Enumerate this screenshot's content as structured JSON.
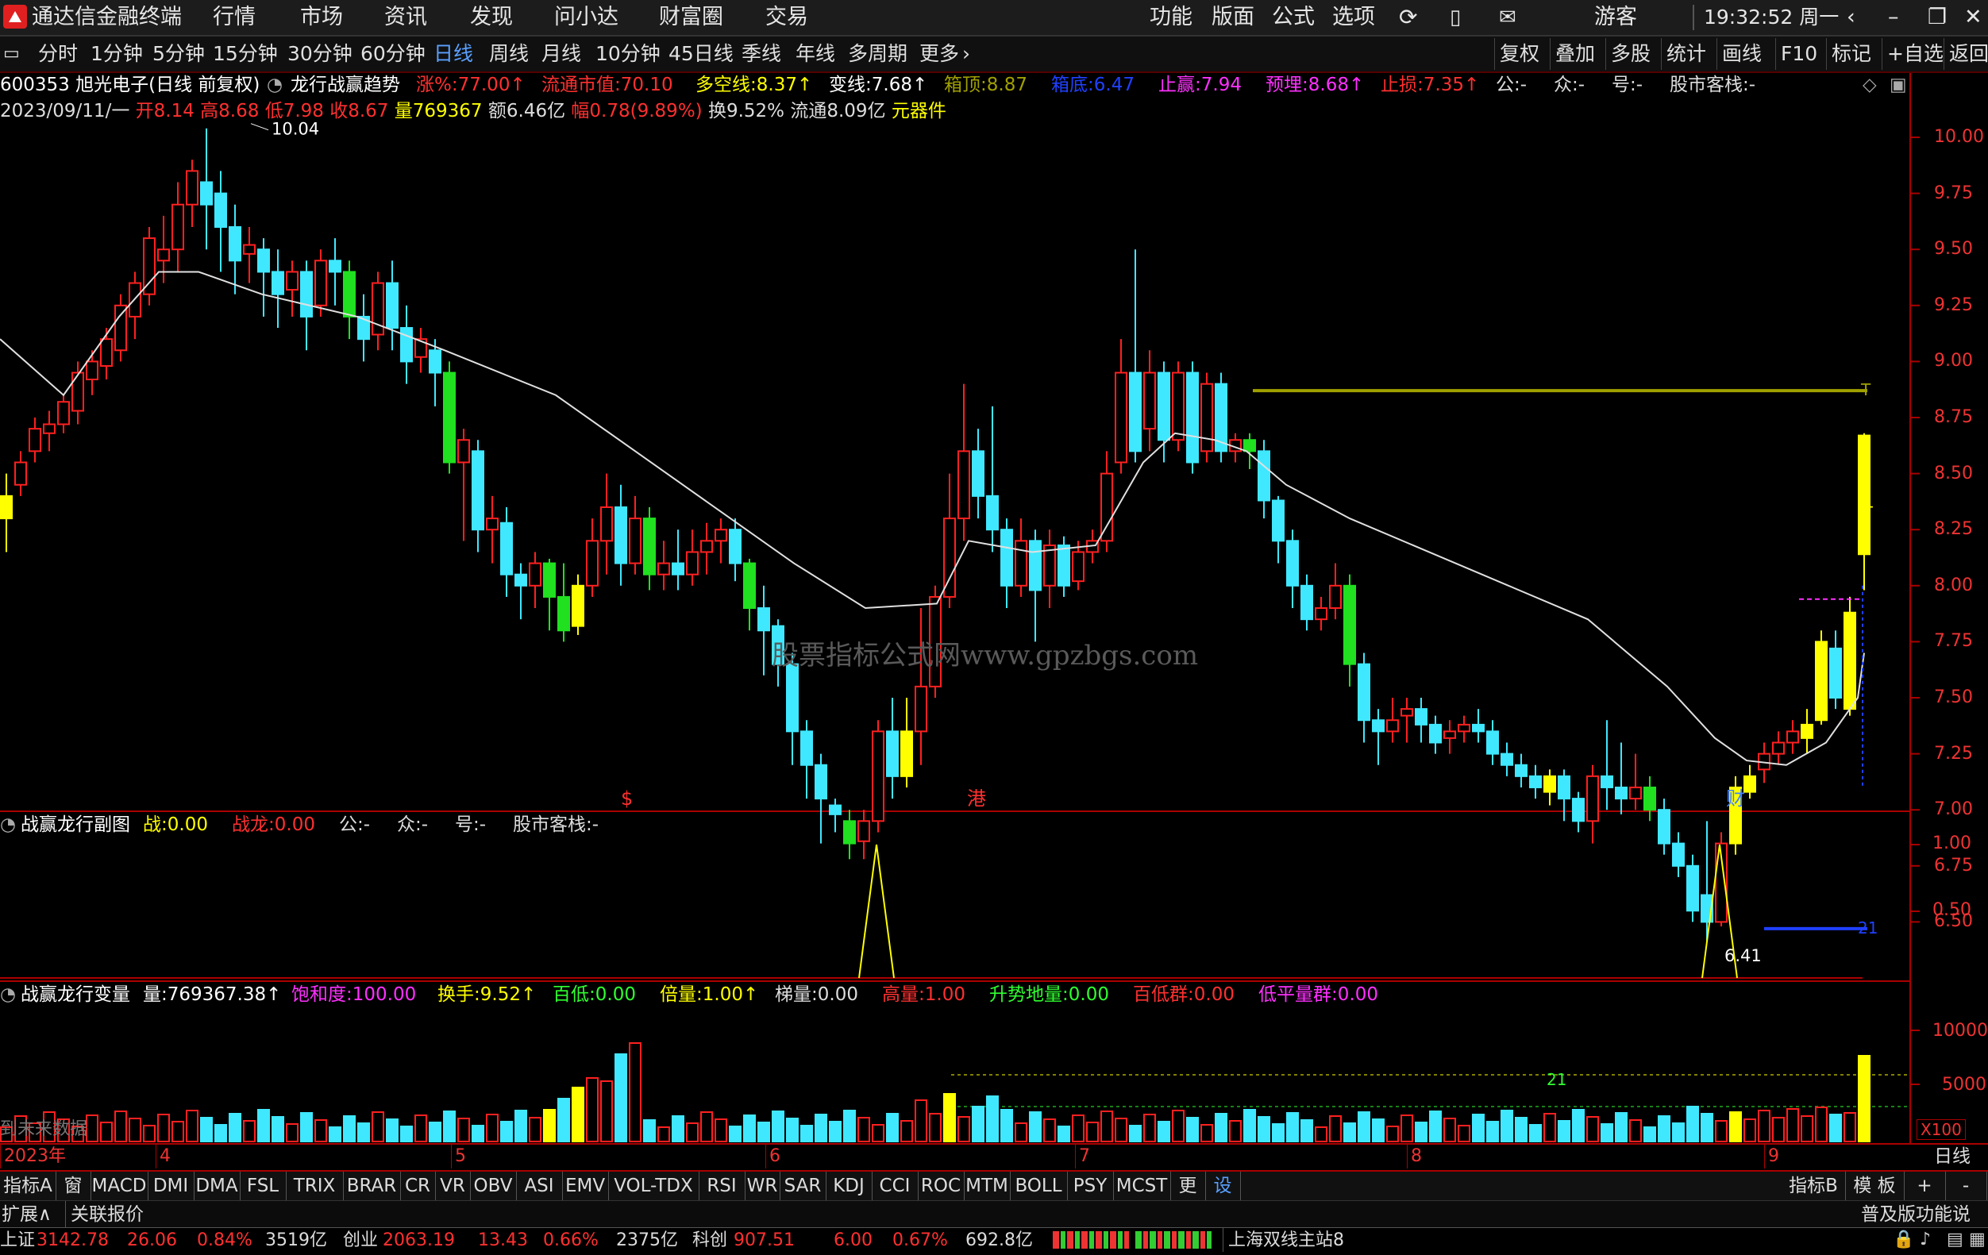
{
  "titlebar": {
    "app_name": "通达信金融终端",
    "menus": [
      "行情",
      "市场",
      "资讯",
      "发现",
      "问小达",
      "财富圈",
      "交易"
    ],
    "right_menus": [
      "功能",
      "版面",
      "公式",
      "选项"
    ],
    "user": "游客",
    "clock": "19:32:52 周一"
  },
  "periods": {
    "items": [
      "分时",
      "1分钟",
      "5分钟",
      "15分钟",
      "30分钟",
      "60分钟",
      "日线",
      "周线",
      "月线",
      "10分钟",
      "45日线",
      "季线",
      "年线",
      "多周期",
      "更多"
    ],
    "active": "日线",
    "right_buttons": [
      "复权",
      "叠加",
      "多股",
      "统计",
      "画线",
      "F10",
      "标记",
      "+自选",
      "返回"
    ]
  },
  "header": {
    "code_name": "600353 旭光电子(日线 前复权)",
    "indicator": "龙行战赢趋势",
    "fields": [
      {
        "label": "涨%:",
        "value": "77.00",
        "color": "#ff3030",
        "arrow": "↑"
      },
      {
        "label": "流通市值:",
        "value": "70.10",
        "color": "#ff3030",
        "arrow": ""
      },
      {
        "label": "多空线:",
        "value": "8.37",
        "color": "#ffff00",
        "arrow": "↑"
      },
      {
        "label": "变线:",
        "value": "7.68",
        "color": "#ffffff",
        "arrow": "↑"
      },
      {
        "label": "箱顶:",
        "value": "8.87",
        "color": "#a0a000",
        "arrow": ""
      },
      {
        "label": "箱底:",
        "value": "6.47",
        "color": "#2040ff",
        "arrow": ""
      },
      {
        "label": "止赢:",
        "value": "7.94",
        "color": "#ff30ff",
        "arrow": ""
      },
      {
        "label": "预埋:",
        "value": "8.68",
        "color": "#ff30ff",
        "arrow": "↑"
      },
      {
        "label": "止损:",
        "value": "7.35",
        "color": "#ff3030",
        "arrow": "↑"
      },
      {
        "label": "公:",
        "value": "-",
        "color": "#dddddd",
        "arrow": ""
      },
      {
        "label": "众:",
        "value": "-",
        "color": "#dddddd",
        "arrow": ""
      },
      {
        "label": "号:",
        "value": "-",
        "color": "#dddddd",
        "arrow": ""
      },
      {
        "label": "股市客栈:",
        "value": "-",
        "color": "#dddddd",
        "arrow": ""
      }
    ],
    "ohlc_line": {
      "date": "2023/09/11/一",
      "open": "开8.14",
      "high": "高8.68",
      "low": "低7.98",
      "close": "收8.67",
      "vol": "量769367",
      "amount": "额6.46亿",
      "range": "幅0.78(9.89%)",
      "turnover": "换9.52%",
      "float": "流通8.09亿",
      "sector": "元器件"
    }
  },
  "main_chart": {
    "price_axis": [
      "10.00",
      "9.75",
      "9.50",
      "9.25",
      "9.00",
      "8.75",
      "8.50",
      "8.25",
      "8.00",
      "7.75",
      "7.50",
      "7.25",
      "7.00",
      "6.75",
      "6.50"
    ],
    "high_label": "10.04",
    "low_label": "6.41",
    "watermark": "股票指标公式网www.gpzbgs.com",
    "markers": [
      {
        "text": "$",
        "color": "#ff3030"
      },
      {
        "text": "港",
        "color": "#ff3030"
      },
      {
        "text": "财",
        "color": "#4080ff"
      }
    ],
    "box_top_label": "T",
    "box_bottom_label": "21",
    "line_label": "1"
  },
  "sub1": {
    "name": "战赢龙行副图",
    "fields": [
      {
        "label": "战:",
        "value": "0.00",
        "color": "#ffff00"
      },
      {
        "label": "战龙:",
        "value": "0.00",
        "color": "#ff3030"
      },
      {
        "label": "公:",
        "value": "-",
        "color": "#dddddd"
      },
      {
        "label": "众:",
        "value": "-",
        "color": "#dddddd"
      },
      {
        "label": "号:",
        "value": "-",
        "color": "#dddddd"
      },
      {
        "label": "股市客栈:",
        "value": "-",
        "color": "#dddddd"
      }
    ],
    "axis": [
      "1.00",
      "0.50"
    ]
  },
  "sub2": {
    "name": "战赢龙行变量",
    "fields": [
      {
        "label": "量:",
        "value": "769367.38",
        "color": "#ffffff",
        "arrow": "↑"
      },
      {
        "label": "饱和度:",
        "value": "100.00",
        "color": "#ff30ff",
        "arrow": ""
      },
      {
        "label": "换手:",
        "value": "9.52",
        "color": "#ffff00",
        "arrow": "↑"
      },
      {
        "label": "百低:",
        "value": "0.00",
        "color": "#30ff30",
        "arrow": ""
      },
      {
        "label": "倍量:",
        "value": "1.00",
        "color": "#ffff00",
        "arrow": "↑"
      },
      {
        "label": "梯量:",
        "value": "0.00",
        "color": "#dddddd",
        "arrow": ""
      },
      {
        "label": "高量:",
        "value": "1.00",
        "color": "#ff3030",
        "arrow": ""
      },
      {
        "label": "升势地量:",
        "value": "0.00",
        "color": "#30ff30",
        "arrow": ""
      },
      {
        "label": "百低群:",
        "value": "0.00",
        "color": "#ff3030",
        "arrow": ""
      },
      {
        "label": "低平量群:",
        "value": "0.00",
        "color": "#ff30ff",
        "arrow": ""
      }
    ],
    "axis": [
      "10000",
      "5000"
    ],
    "unit": "X100",
    "label_21": "21",
    "future_text": "到未来数据"
  },
  "time_axis": {
    "labels": [
      "2023年",
      "4",
      "5",
      "6",
      "7",
      "8",
      "9"
    ],
    "period": "日线"
  },
  "indicator_tabs": {
    "left": "指标A",
    "items": [
      "窗口",
      "MACD",
      "DMI",
      "DMA",
      "FSL",
      "TRIX",
      "BRAR",
      "CR",
      "VR",
      "OBV",
      "ASI",
      "EMV",
      "VOL-TDX",
      "RSI",
      "WR",
      "SAR",
      "KDJ",
      "CCI",
      "ROC",
      "MTM",
      "BOLL",
      "PSY",
      "MCST",
      "更多",
      "设置"
    ],
    "right": [
      "指标B",
      "模 板",
      "+",
      "-"
    ]
  },
  "ext_bar": {
    "left": "扩展∧",
    "link": "关联报价",
    "right": "普及版功能说明"
  },
  "status": {
    "sh_label": "上证",
    "sh_val": "3142.78",
    "sh_chg": "26.06",
    "sh_pct": "0.84%",
    "sh_amt": "3519亿",
    "cy_label": "创业",
    "cy_val": "2063.19",
    "cy_chg": "13.43",
    "cy_pct": "0.66%",
    "cy_amt": "2375亿",
    "kc_label": "科创",
    "kc_val": "907.51",
    "kc_chg": "6.00",
    "kc_pct": "0.67%",
    "kc_amt": "692.8亿",
    "server": "上海双线主站8"
  }
}
